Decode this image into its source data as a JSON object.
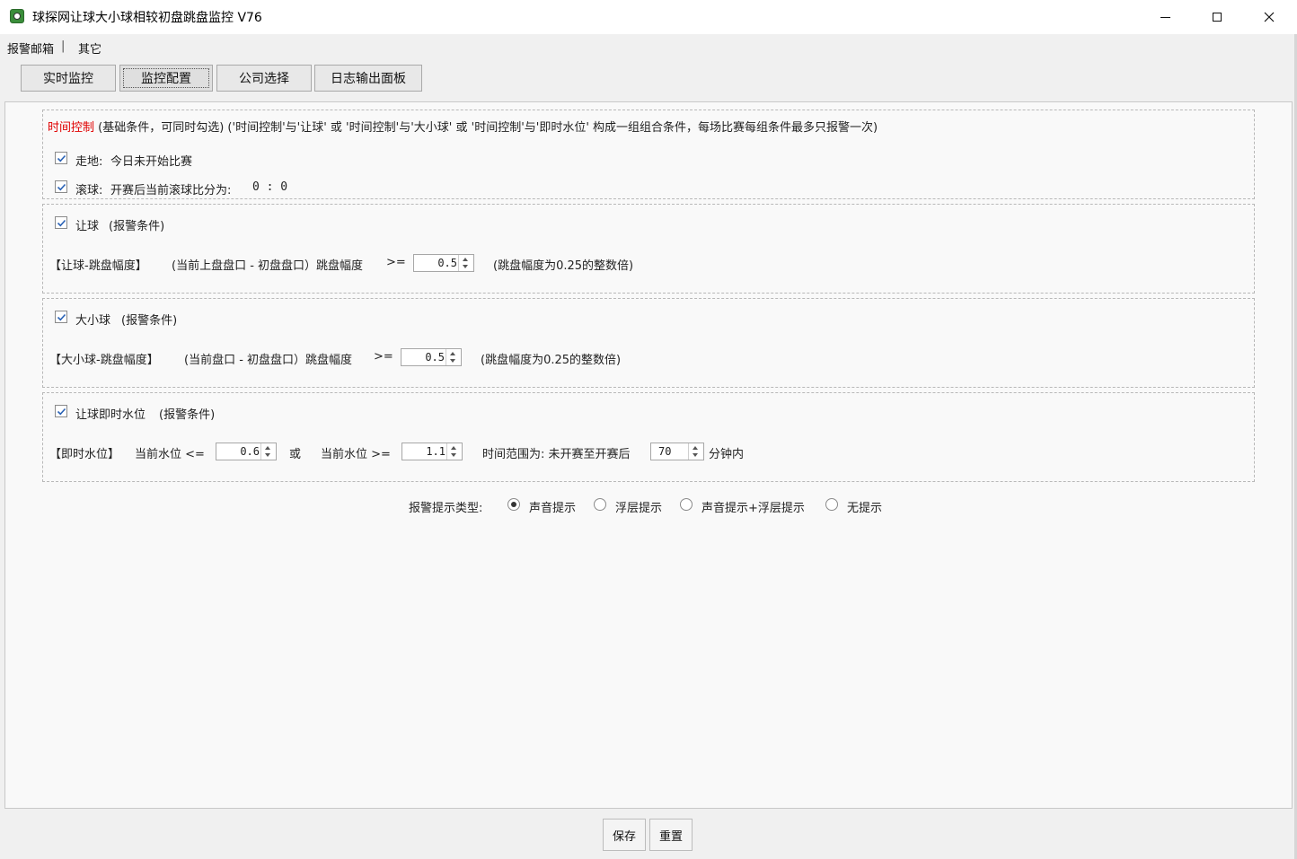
{
  "window": {
    "title": "球探网让球大小球相较初盘跳盘监控 V76",
    "controls": {
      "minimize_icon": "minimize-icon",
      "maximize_icon": "maximize-icon",
      "close_icon": "close-icon"
    }
  },
  "menubar": {
    "items": [
      "报警邮箱",
      "其它"
    ],
    "separator": "|"
  },
  "tabs": [
    {
      "label": "实时监控",
      "active": false
    },
    {
      "label": "监控配置",
      "active": true
    },
    {
      "label": "公司选择",
      "active": false
    },
    {
      "label": "日志输出面板",
      "active": false
    }
  ],
  "time_control": {
    "heading": "时间控制",
    "description": " (基础条件，可同时勾选) ('时间控制'与'让球' 或 '时间控制'与'大小球' 或 '时间控制'与'即时水位' 构成一组组合条件，每场比赛每组条件最多只报警一次)",
    "walk": {
      "label": "走地:",
      "text": "今日未开始比赛",
      "checked": true
    },
    "rolling": {
      "label": "滚球:",
      "text": "开赛后当前滚球比分为:",
      "score": "0 : 0",
      "checked": true
    }
  },
  "handicap": {
    "label": "让球",
    "suffix": "(报警条件)",
    "checked": true,
    "row_label": "【让球-跳盘幅度】",
    "formula": "(当前上盘盘口 - 初盘盘口）跳盘幅度",
    "operator": ">=",
    "value": "0.5",
    "hint": "(跳盘幅度为0.25的整数倍)"
  },
  "overunder": {
    "label": "大小球",
    "suffix": "(报警条件)",
    "checked": true,
    "row_label": "【大小球-跳盘幅度】",
    "formula": "(当前盘口 - 初盘盘口）跳盘幅度",
    "operator": ">=",
    "value": "0.5",
    "hint": "(跳盘幅度为0.25的整数倍)"
  },
  "odds": {
    "label": "让球即时水位",
    "suffix": "(报警条件)",
    "checked": true,
    "row_label": "【即时水位】",
    "low_label": "当前水位 <=",
    "low_value": "0.6",
    "or_label": "或",
    "high_label": "当前水位 >=",
    "high_value": "1.1",
    "range_label": "时间范围为: 未开赛至开赛后",
    "minutes": "70",
    "minutes_suffix": "分钟内"
  },
  "alert_type": {
    "label": "报警提示类型:",
    "options": [
      {
        "label": "声音提示",
        "selected": true
      },
      {
        "label": "浮层提示",
        "selected": false
      },
      {
        "label": "声音提示+浮层提示",
        "selected": false
      },
      {
        "label": "无提示",
        "selected": false
      }
    ]
  },
  "footer": {
    "save": "保存",
    "reset": "重置"
  }
}
